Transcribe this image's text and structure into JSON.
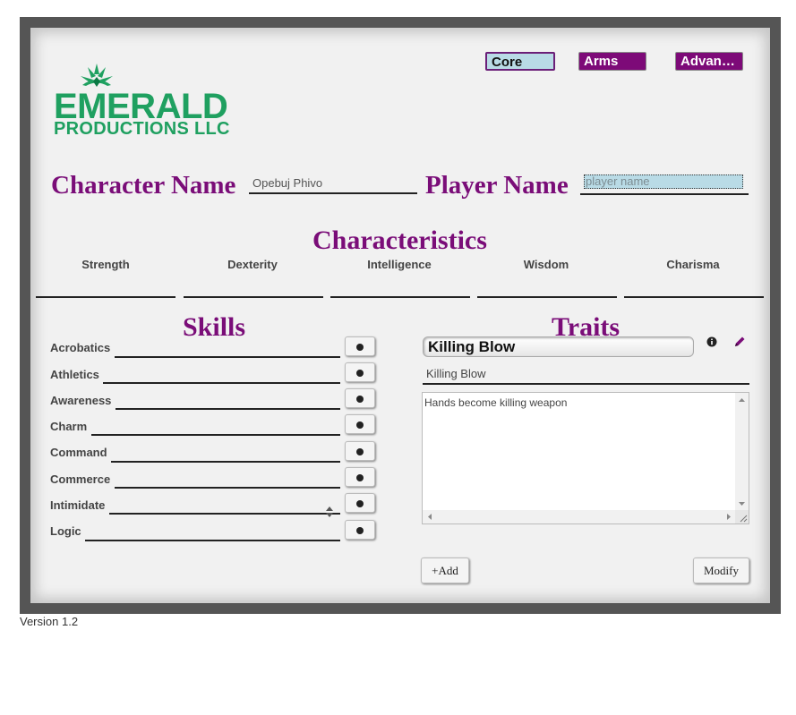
{
  "tabs": [
    {
      "label": "Core",
      "active": true
    },
    {
      "label": "Arms",
      "active": false
    },
    {
      "label": "Advan…",
      "active": false
    }
  ],
  "logo": {
    "line1": "EMERALD",
    "line2": "PRODUCTIONS LLC",
    "color": "#1fa060"
  },
  "character": {
    "label": "Character Name",
    "value": "Opebuj Phivo"
  },
  "player": {
    "label": "Player Name",
    "placeholder": "player name",
    "value": ""
  },
  "characteristics": {
    "title": "Characteristics",
    "stats": [
      "Strength",
      "Dexterity",
      "Intelligence",
      "Wisdom",
      "Charisma"
    ]
  },
  "skills": {
    "title": "Skills",
    "items": [
      "Acrobatics",
      "Athletics",
      "Awareness",
      "Charm",
      "Command",
      "Commerce",
      "Intimidate",
      "Logic"
    ],
    "dice_icon": "dice-icon"
  },
  "traits": {
    "title": "Traits",
    "selected": "Killing Blow",
    "name": "Killing Blow",
    "description": "Hands become killing weapon",
    "add_label": "+Add",
    "modify_label": "Modify",
    "info_icon": "info-icon",
    "edit_icon": "pencil-icon"
  },
  "version": "Version 1.2",
  "colors": {
    "accent": "#7a0d78",
    "tab_active": "#b9dbe6",
    "tab_inactive": "#7d0a78"
  }
}
